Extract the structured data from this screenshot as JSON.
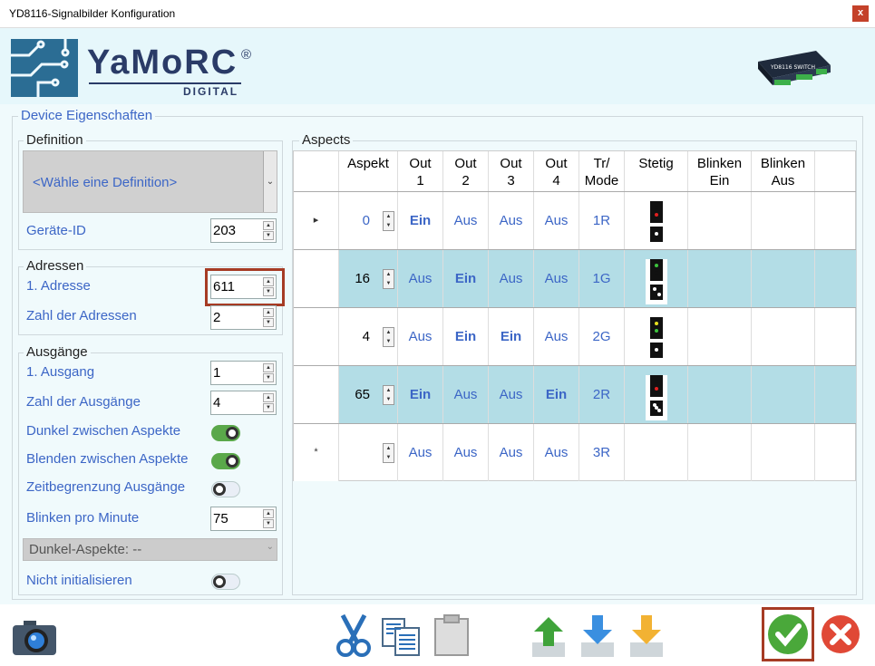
{
  "window": {
    "title": "YD8116-Signalbilder Konfiguration",
    "close": "x"
  },
  "brand": {
    "name": "YaMoRC",
    "reg": "®",
    "sub": "DIGITAL",
    "device_label": "YD8116 SWITCH"
  },
  "props": {
    "legend": "Device Eigenschaften",
    "definition": {
      "legend": "Definition",
      "select": "<Wähle eine Definition>",
      "id_label": "Geräte-ID",
      "id_value": "203"
    },
    "adressen": {
      "legend": "Adressen",
      "first_label": "1. Adresse",
      "first_value": "611",
      "count_label": "Zahl der Adressen",
      "count_value": "2"
    },
    "ausgaenge": {
      "legend": "Ausgänge",
      "first_label": "1. Ausgang",
      "first_value": "1",
      "count_label": "Zahl der Ausgänge",
      "count_value": "4",
      "dark_label": "Dunkel zwischen Aspekte",
      "dark_on": true,
      "fade_label": "Blenden zwischen Aspekte",
      "fade_on": true,
      "time_label": "Zeitbegrenzung Ausgänge",
      "time_on": false,
      "blink_label": "Blinken pro Minute",
      "blink_value": "75",
      "dark_aspect": "Dunkel-Aspekte: --",
      "noinit_label": "Nicht initialisieren",
      "noinit_on": false
    }
  },
  "aspects": {
    "legend": "Aspects",
    "columns": [
      {
        "l1": "",
        "l2": ""
      },
      {
        "l1": "Aspekt",
        "l2": ""
      },
      {
        "l1": "Out",
        "l2": "1"
      },
      {
        "l1": "Out",
        "l2": "2"
      },
      {
        "l1": "Out",
        "l2": "3"
      },
      {
        "l1": "Out",
        "l2": "4"
      },
      {
        "l1": "Tr/",
        "l2": "Mode"
      },
      {
        "l1": "Stetig",
        "l2": ""
      },
      {
        "l1": "Blinken",
        "l2": "Ein"
      },
      {
        "l1": "Blinken",
        "l2": "Aus"
      }
    ],
    "rows": [
      {
        "marker": "▸",
        "aspekt": "0",
        "outs": [
          "Ein",
          "Aus",
          "Aus",
          "Aus"
        ],
        "mode": "1R",
        "sig_top": [
          "#111",
          "#e02020"
        ],
        "sig_bot": [
          "#fff"
        ],
        "highlight": false
      },
      {
        "marker": "",
        "aspekt": "16",
        "outs": [
          "Aus",
          "Ein",
          "Aus",
          "Aus"
        ],
        "mode": "1G",
        "sig_top": [
          "#3dc23d",
          "#111"
        ],
        "sig_bot": [
          "#fff",
          "#fff"
        ],
        "highlight": true
      },
      {
        "marker": "",
        "aspekt": "4",
        "outs": [
          "Aus",
          "Ein",
          "Ein",
          "Aus"
        ],
        "mode": "2G",
        "sig_top": [
          "#e8e020",
          "#3dc23d"
        ],
        "sig_bot": [
          "#fff"
        ],
        "highlight": false
      },
      {
        "marker": "",
        "aspekt": "65",
        "outs": [
          "Ein",
          "Aus",
          "Aus",
          "Ein"
        ],
        "mode": "2R",
        "sig_top": [
          "#111",
          "#e02020"
        ],
        "sig_bot": [
          "#fff",
          "#fff",
          "#fff"
        ],
        "highlight": true
      },
      {
        "marker": "*",
        "aspekt": "",
        "outs": [
          "Aus",
          "Aus",
          "Aus",
          "Aus"
        ],
        "mode": "3R",
        "sig_top": null,
        "sig_bot": null,
        "highlight": false
      }
    ]
  },
  "colors": {
    "row_highlight": "#b3dde6",
    "toggle_on": "#5aa84a",
    "toggle_off": "#e9eef6",
    "accent": "#3c66c6"
  },
  "toolbar": [
    "camera-icon",
    "scissors-icon",
    "copy-icon",
    "paste-icon",
    "move-up-icon",
    "move-down-icon",
    "move-up-yellow-icon",
    "ok-icon",
    "cancel-icon"
  ]
}
